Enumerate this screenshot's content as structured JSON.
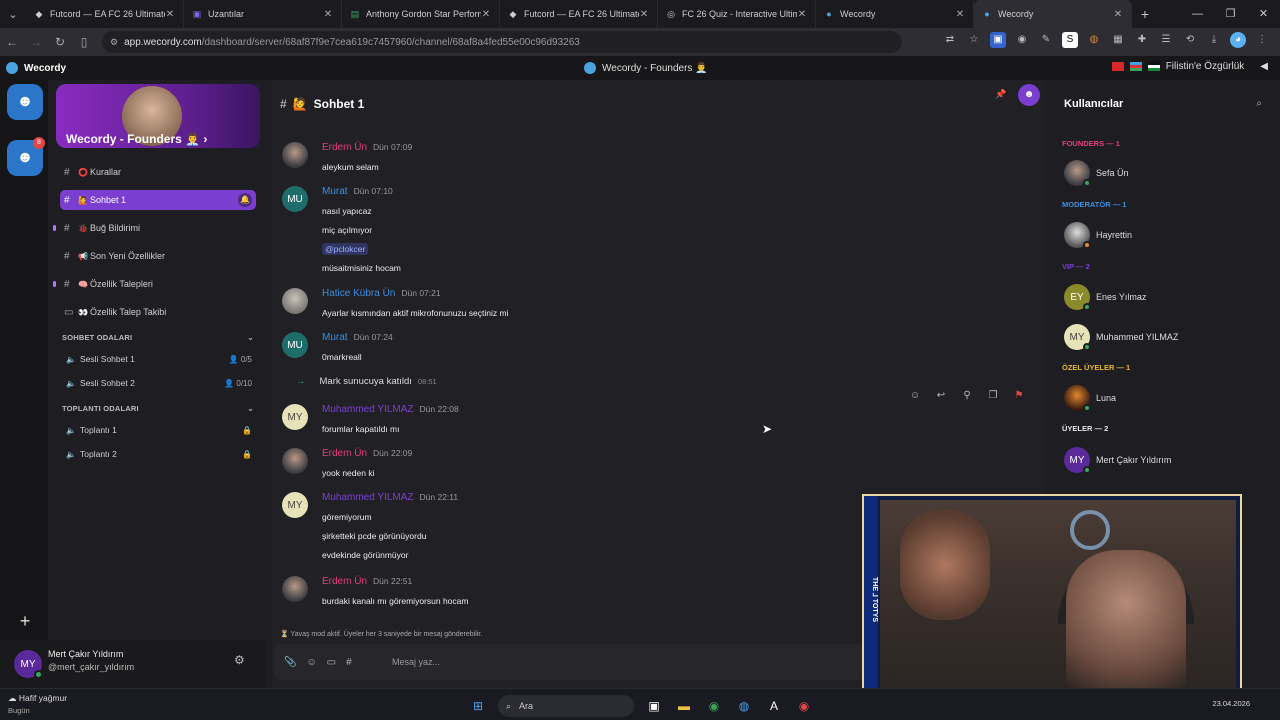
{
  "browser": {
    "tabs": [
      {
        "title": "Futcord — EA FC 26 Ultimate Te",
        "icon": "futcord-icon",
        "active": false
      },
      {
        "title": "Uzantılar",
        "icon": "extensions-icon",
        "active": false
      },
      {
        "title": "Anthony Gordon Star Performe",
        "icon": "futbin-icon",
        "active": false
      },
      {
        "title": "Futcord — EA FC 26 Ultimate Te",
        "icon": "futcord-icon",
        "active": false
      },
      {
        "title": "FC 26 Quiz - Interactive Ultimat",
        "icon": "globe-icon",
        "active": false
      },
      {
        "title": "Wecordy",
        "icon": "wecordy-icon",
        "active": false
      },
      {
        "title": "Wecordy",
        "icon": "wecordy-icon",
        "active": true
      }
    ],
    "url_host": "app.wecordy.com",
    "url_path": "/dashboard/server/68af87f9e7cea619c7457960/channel/68af8a4fed55e00c96d93263"
  },
  "app": {
    "name": "Wecordy",
    "center_title": "Wecordy - Founders 👨‍💼",
    "right_text": "Filistin'e Özgürlük"
  },
  "server": {
    "name": "Wecordy - Founders 👨‍💼",
    "badge": "8",
    "channels": [
      {
        "label": "Kurallar",
        "emoji": "⭕"
      },
      {
        "label": "Sohbet 1",
        "emoji": "🙋"
      },
      {
        "label": "Buğ Bildirimi",
        "emoji": "🐞"
      },
      {
        "label": "Son Yeni Özellikler",
        "emoji": "📢"
      },
      {
        "label": "Özellik Talepleri",
        "emoji": "🧠"
      },
      {
        "label": "Özellik Talep Takibi",
        "emoji": "👀"
      }
    ],
    "voice_category": "SOHBET ODALARI",
    "voice_channels": [
      {
        "label": "Sesli Sohbet 1",
        "count": "0/5"
      },
      {
        "label": "Sesli Sohbet 2",
        "count": "0/10"
      }
    ],
    "meeting_category": "TOPLANTI ODALARI",
    "meeting_channels": [
      {
        "label": "Toplantı 1"
      },
      {
        "label": "Toplantı 2"
      }
    ]
  },
  "user": {
    "initials": "MY",
    "name": "Mert Çakır Yıldırım",
    "handle": "@mert_çakır_yıldırım"
  },
  "chat": {
    "channel_title": "Sohbet 1",
    "channel_emoji": "🙋",
    "messages": [
      {
        "author": "Erdem Ün",
        "time": "Dün 07:09",
        "color": "#e0407a",
        "avatar": "photo",
        "lines": [
          "aleykum selam"
        ]
      },
      {
        "author": "Murat",
        "time": "Dün 07:10",
        "color": "#3d8fe0",
        "avatar": "MU",
        "lines": [
          "nasıl yapıcaz",
          "miç açılmıyor",
          "müsaitmisiniz hocam"
        ],
        "mention": "@pclokcer"
      },
      {
        "author": "Hatice Kübra Ün",
        "time": "Dün 07:21",
        "color": "#3d8fe0",
        "avatar": "photo",
        "lines": [
          "Ayarlar kısmından aktif mikrofonunuzu seçtiniz mi"
        ]
      },
      {
        "author": "Murat",
        "time": "Dün 07:24",
        "color": "#3d8fe0",
        "avatar": "MU",
        "lines": [
          "0markreall"
        ]
      },
      {
        "author": "Muhammed YILMAZ",
        "time": "Dün 22:08",
        "color": "#7a3fd1",
        "avatar": "MY",
        "lines": [
          "forumlar kapatıldı mı"
        ]
      },
      {
        "author": "Erdem Ün",
        "time": "Dün 22:09",
        "color": "#e0407a",
        "avatar": "photo",
        "lines": [
          "yook neden ki"
        ]
      },
      {
        "author": "Muhammed YILMAZ",
        "time": "Dün 22:11",
        "color": "#7a3fd1",
        "avatar": "MY",
        "lines": [
          "göremiyorum",
          "şirketteki pcde görünüyordu",
          "evdekinde görünmüyor"
        ]
      },
      {
        "author": "Erdem Ün",
        "time": "Dün 22:51",
        "color": "#e0407a",
        "avatar": "photo",
        "lines": [
          "burdaki kanalı mı göremiyorsun hocam"
        ]
      }
    ],
    "join": {
      "name": "Mark",
      "text": "sunucuya katıldı",
      "time": "08:51"
    },
    "slowmode": "Yavaş mod aktif. Üyeler her 3 saniyede bir mesaj gönderebilir.",
    "input_placeholder": "Mesaj yaz..."
  },
  "users_panel": {
    "title": "Kullanıcılar",
    "roles": [
      {
        "label": "FOUNDERS — 1",
        "color": "#e0407a"
      },
      {
        "label": "MODERATÖR — 1",
        "color": "#3d8fe0"
      },
      {
        "label": "VIP — 2",
        "color": "#7a3fd1"
      },
      {
        "label": "ÖZEL ÜYELER — 1",
        "color": "#e8b830"
      },
      {
        "label": "ÜYELER — 2",
        "color": "#e6e6e6"
      }
    ],
    "members": [
      {
        "name": "Sefa Ün",
        "initials": ""
      },
      {
        "name": "Hayrettin",
        "initials": ""
      },
      {
        "name": "Enes Yılmaz",
        "initials": "EY"
      },
      {
        "name": "Muhammed YILMAZ",
        "initials": "MY"
      },
      {
        "name": "Luna",
        "initials": ""
      },
      {
        "name": "Mert Çakır Yıldırım",
        "initials": "MY"
      }
    ]
  },
  "webcam": {
    "strip_text": "THE ⅃ TOTYS"
  },
  "taskbar": {
    "weather": "Hafif yağmur",
    "weather_sub": "Bugün",
    "search": "Ara",
    "date": "23.04.2026"
  }
}
